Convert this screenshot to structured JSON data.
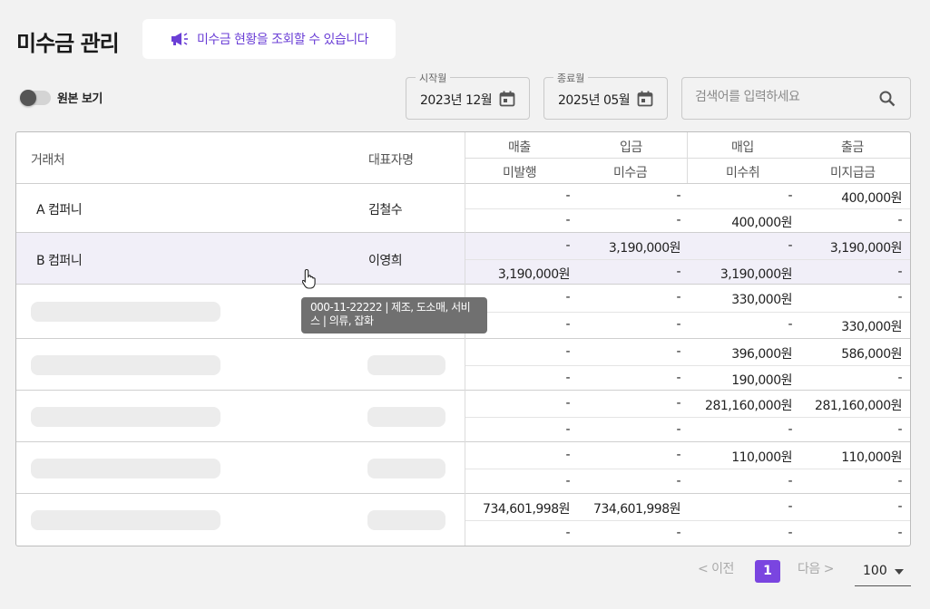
{
  "header": {
    "title": "미수금 관리",
    "notice": "미수금 현황을 조회할 수 있습니다",
    "notice_icon": "megaphone-icon",
    "accent": "#6b3fd6"
  },
  "filters": {
    "toggle_label": "원본 보기",
    "start_label": "시작월",
    "start_value": "2023년 12월",
    "end_label": "종료월",
    "end_value": "2025년 05월",
    "search_placeholder": "검색어를 입력하세요"
  },
  "table": {
    "headers": {
      "client": "거래처",
      "rep": "대표자명",
      "sales": "매출",
      "deposit": "입금",
      "purchase": "매입",
      "withdraw": "출금",
      "unissued": "미발행",
      "receivable": "미수금",
      "unreceived": "미수취",
      "unpaid": "미지급금"
    },
    "rows": [
      {
        "name": "A 컴퍼니",
        "rep": "김철수",
        "top": [
          "-",
          "-",
          "-",
          "400,000원"
        ],
        "bottom": [
          "-",
          "-",
          "400,000원",
          "-"
        ]
      },
      {
        "name": "B 컴퍼니",
        "rep": "이영희",
        "top": [
          "-",
          "3,190,000원",
          "-",
          "3,190,000원"
        ],
        "bottom": [
          "3,190,000원",
          "-",
          "3,190,000원",
          "-"
        ]
      },
      {
        "name": "",
        "rep": "",
        "top": [
          "-",
          "-",
          "330,000원",
          "-"
        ],
        "bottom": [
          "-",
          "-",
          "-",
          "330,000원"
        ]
      },
      {
        "name": "",
        "rep": "",
        "top": [
          "-",
          "-",
          "396,000원",
          "586,000원"
        ],
        "bottom": [
          "-",
          "-",
          "190,000원",
          "-"
        ]
      },
      {
        "name": "",
        "rep": "",
        "top": [
          "-",
          "-",
          "281,160,000원",
          "281,160,000원"
        ],
        "bottom": [
          "-",
          "-",
          "-",
          "-"
        ]
      },
      {
        "name": "",
        "rep": "",
        "top": [
          "-",
          "-",
          "110,000원",
          "110,000원"
        ],
        "bottom": [
          "-",
          "-",
          "-",
          "-"
        ]
      },
      {
        "name": "",
        "rep": "",
        "top": [
          "734,601,998원",
          "734,601,998원",
          "-",
          "-"
        ],
        "bottom": [
          "-",
          "-",
          "-",
          "-"
        ]
      }
    ]
  },
  "tooltip": {
    "text": "000-11-22222 | 제조, 도소매, 서비스 | 의류, 잡화"
  },
  "pagination": {
    "prev": "< 이전",
    "current": "1",
    "next": "다음 >",
    "page_size": "100"
  }
}
